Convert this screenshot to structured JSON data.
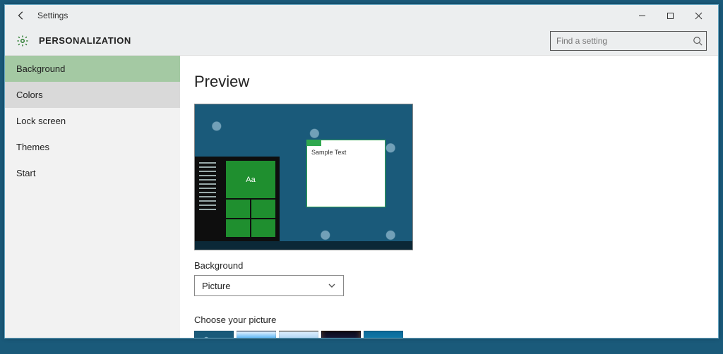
{
  "window": {
    "title": "Settings"
  },
  "header": {
    "page_title": "PERSONALIZATION",
    "search_placeholder": "Find a setting"
  },
  "sidebar": {
    "items": [
      {
        "label": "Background",
        "active": true
      },
      {
        "label": "Colors"
      },
      {
        "label": "Lock screen"
      },
      {
        "label": "Themes"
      },
      {
        "label": "Start"
      }
    ]
  },
  "content": {
    "preview_heading": "Preview",
    "sample_window_title": "Sample Text",
    "sample_tile_text": "Aa",
    "background_label": "Background",
    "background_selected": "Picture",
    "choose_picture_label": "Choose your picture"
  }
}
